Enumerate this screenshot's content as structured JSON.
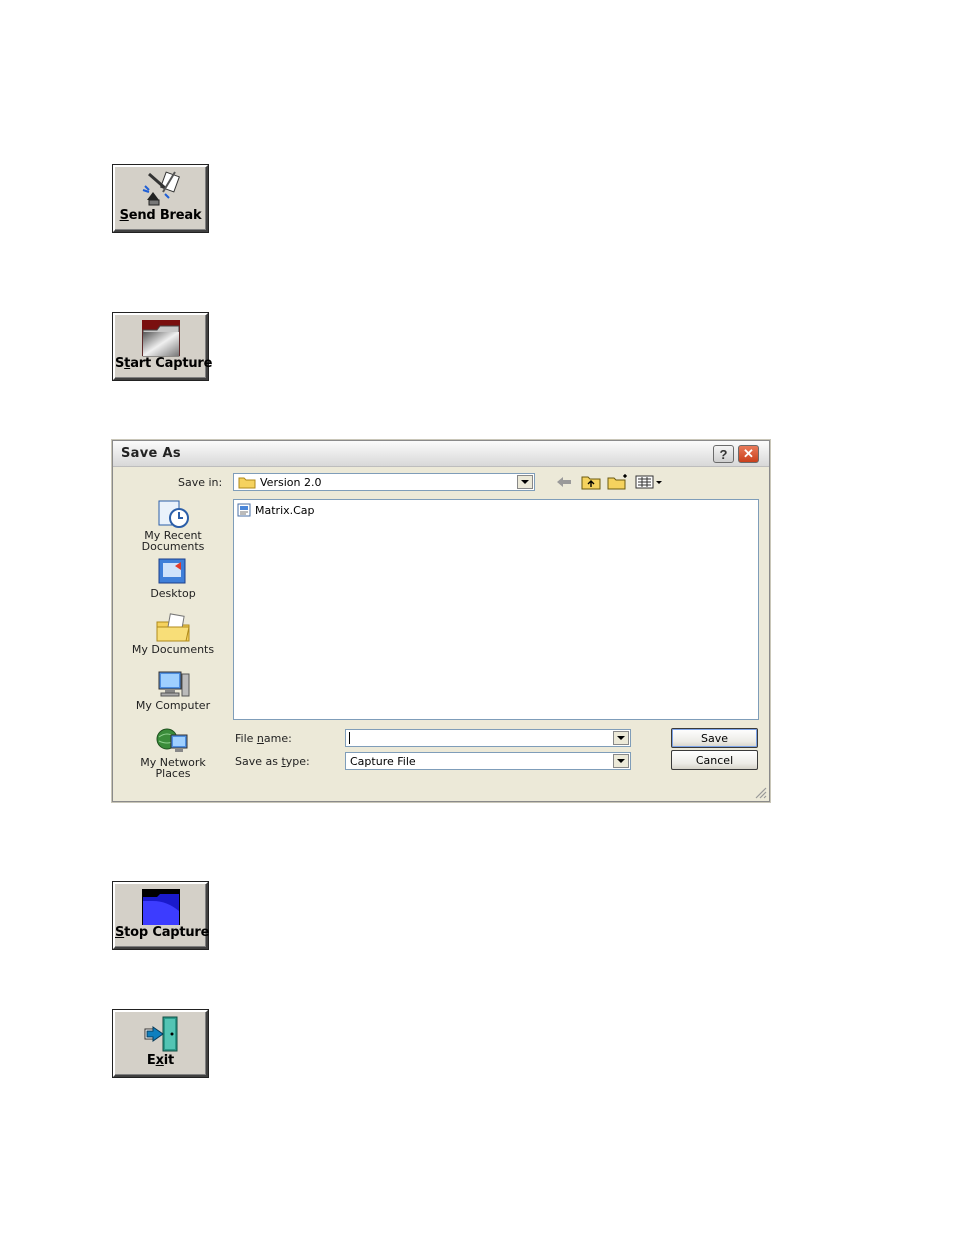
{
  "buttons": {
    "send_break": {
      "prefix": "",
      "underline": "S",
      "rest": "end Break"
    },
    "start_capture": {
      "prefix": "S",
      "underline": "t",
      "rest": "art Capture"
    },
    "stop_capture": {
      "prefix": "",
      "underline": "S",
      "rest": "top Capture"
    },
    "exit": {
      "prefix": "E",
      "underline": "x",
      "rest": "it"
    }
  },
  "dialog": {
    "title": "Save As",
    "help_glyph": "?",
    "close_glyph": "✕",
    "save_in_label": "Save in:",
    "save_in_value": "Version 2.0",
    "places": [
      {
        "label": "My Recent\nDocuments",
        "icon": "recent-documents-icon"
      },
      {
        "label": "Desktop",
        "icon": "desktop-icon"
      },
      {
        "label": "My Documents",
        "icon": "my-documents-icon"
      },
      {
        "label": "My Computer",
        "icon": "my-computer-icon"
      },
      {
        "label": "My Network\nPlaces",
        "icon": "network-places-icon"
      }
    ],
    "files": [
      {
        "name": "Matrix.Cap",
        "icon": "file-icon"
      }
    ],
    "file_name_label": "File name:",
    "file_name_value": "",
    "save_type_label": "Save as type:",
    "save_type_value": "Capture File",
    "save_button": "Save",
    "cancel_button": "Cancel"
  }
}
